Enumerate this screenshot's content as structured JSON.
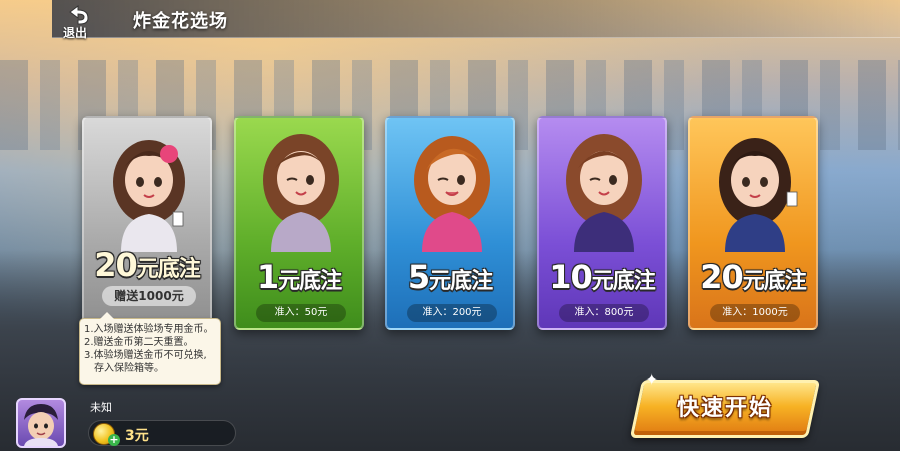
{
  "header": {
    "back_label": "退出",
    "title": "炸金花选场"
  },
  "rooms": [
    {
      "theme": "gray",
      "stake_num": "20",
      "stake_unit": "元底注",
      "bonus": "赠送1000元",
      "entry": "",
      "accent": "#a9a9a9"
    },
    {
      "theme": "green",
      "stake_num": "1",
      "stake_unit": "元底注",
      "entry": "准入：50元",
      "accent": "#5fae2a"
    },
    {
      "theme": "blue",
      "stake_num": "5",
      "stake_unit": "元底注",
      "entry": "准入：200元",
      "accent": "#2f8fd6"
    },
    {
      "theme": "purple",
      "stake_num": "10",
      "stake_unit": "元底注",
      "entry": "准入：800元",
      "accent": "#7b4fd6"
    },
    {
      "theme": "orange",
      "stake_num": "20",
      "stake_unit": "元底注",
      "entry": "准入：1000元",
      "accent": "#f0961e"
    }
  ],
  "tooltip": {
    "lines": [
      "1.入场赠送体验场专用金币。",
      "2.赠送金币第二天重置。",
      "3.体验场赠送金币不可兑换,",
      "存入保险箱等。"
    ]
  },
  "player": {
    "name": "未知",
    "coins": "3元",
    "coin_icon": "gold-coin-icon",
    "plus_icon": "plus-icon"
  },
  "quick_start": {
    "label": "快速开始"
  }
}
